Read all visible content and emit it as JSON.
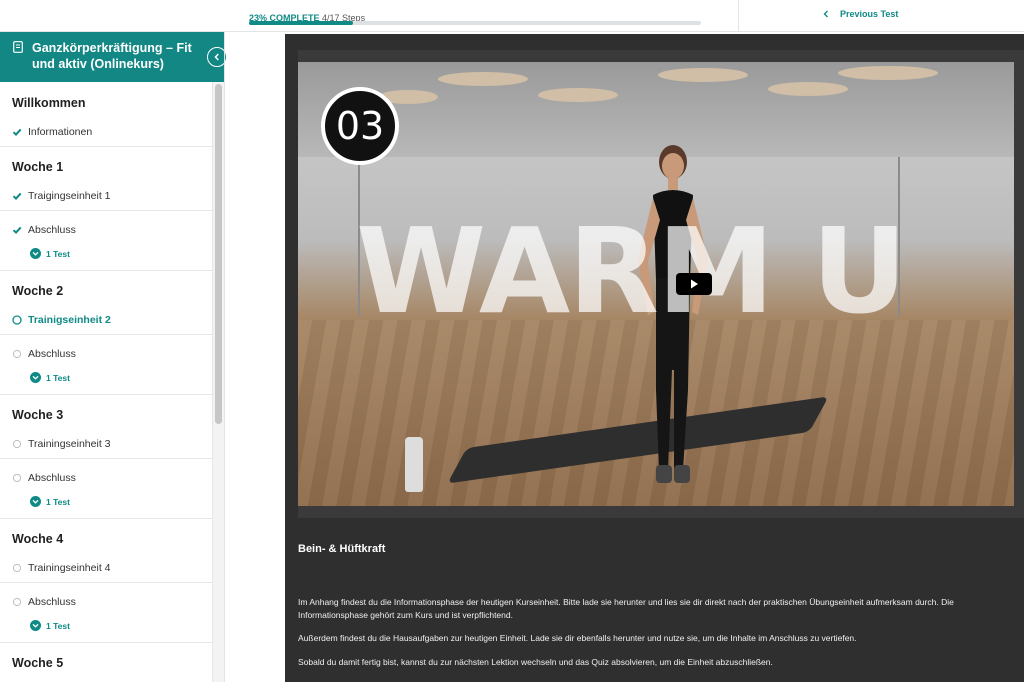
{
  "topbar": {
    "progress_percent_label": "23% COMPLETE",
    "progress_steps": "4/17 Steps",
    "progress_value": 0.23,
    "previous_test_label": "Previous Test"
  },
  "sidebar": {
    "course_title": "Ganzkörperkräftigung – Fit und aktiv (Onlinekurs)",
    "sections": [
      {
        "title": "Willkommen",
        "items": [
          {
            "label": "Informationen",
            "status": "done"
          }
        ]
      },
      {
        "title": "Woche 1",
        "items": [
          {
            "label": "Traigingseinheit 1",
            "status": "done"
          },
          {
            "label": "Abschluss",
            "status": "done",
            "test": "1 Test"
          }
        ]
      },
      {
        "title": "Woche 2",
        "items": [
          {
            "label": "Trainigseinheit 2",
            "status": "current"
          },
          {
            "label": "Abschluss",
            "status": "open",
            "test": "1 Test"
          }
        ]
      },
      {
        "title": "Woche 3",
        "items": [
          {
            "label": "Trainingseinheit 3",
            "status": "open"
          },
          {
            "label": "Abschluss",
            "status": "open",
            "test": "1 Test"
          }
        ]
      },
      {
        "title": "Woche 4",
        "items": [
          {
            "label": "Trainingseinheit 4",
            "status": "open"
          },
          {
            "label": "Abschluss",
            "status": "open",
            "test": "1 Test"
          }
        ]
      },
      {
        "title": "Woche 5",
        "items": []
      }
    ]
  },
  "video": {
    "badge_number": "03",
    "overlay_text": "WARM U"
  },
  "lesson": {
    "title": "Bein- & Hüftkraft",
    "paragraphs": [
      "Im Anhang findest du die Informationsphase der heutigen Kurseinheit. Bitte lade sie herunter und lies sie dir direkt nach der praktischen Übungseinheit aufmerksam durch. Die Informationsphase gehört zum Kurs und ist verpflichtend.",
      "Außerdem findest du die Hausaufgaben zur heutigen Einheit. Lade sie dir ebenfalls herunter und nutze sie, um die Inhalte im Anschluss zu vertiefen.",
      "Sobald du damit fertig bist, kannst du zur nächsten Lektion wechseln und das Quiz absolvieren, um die Einheit abzuschließen."
    ]
  },
  "colors": {
    "accent": "#0f8a86",
    "header": "#128784",
    "panel": "#2f2f2f"
  }
}
